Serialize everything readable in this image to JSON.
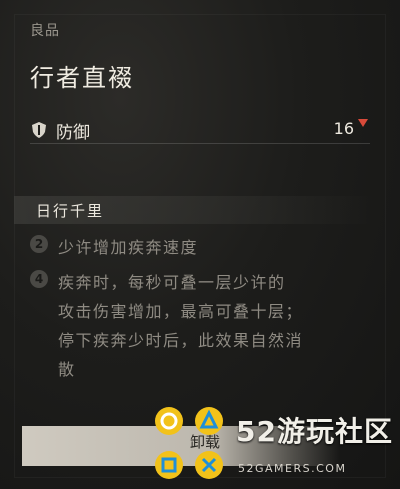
{
  "item": {
    "quality": "良品",
    "name": "行者直裰"
  },
  "stat": {
    "icon": "shield-icon",
    "label": "防御",
    "value": "16",
    "change_indicator": "down-arrow-icon",
    "change_color": "#d84a3a"
  },
  "set_effect": {
    "title": "日行千里",
    "effects": [
      {
        "count": "2",
        "lines": [
          "少许增加疾奔速度"
        ]
      },
      {
        "count": "4",
        "lines": [
          "疾奔时，每秒可叠一层少许的",
          "攻击伤害增加，最高可叠十层；",
          "停下疾奔少时后，此效果自然消",
          "散"
        ]
      }
    ]
  },
  "action": {
    "label": "卸载"
  },
  "watermark": {
    "brand": "52游玩社区",
    "url": "52GAMERS.COM",
    "accent": "#f2c21a"
  }
}
